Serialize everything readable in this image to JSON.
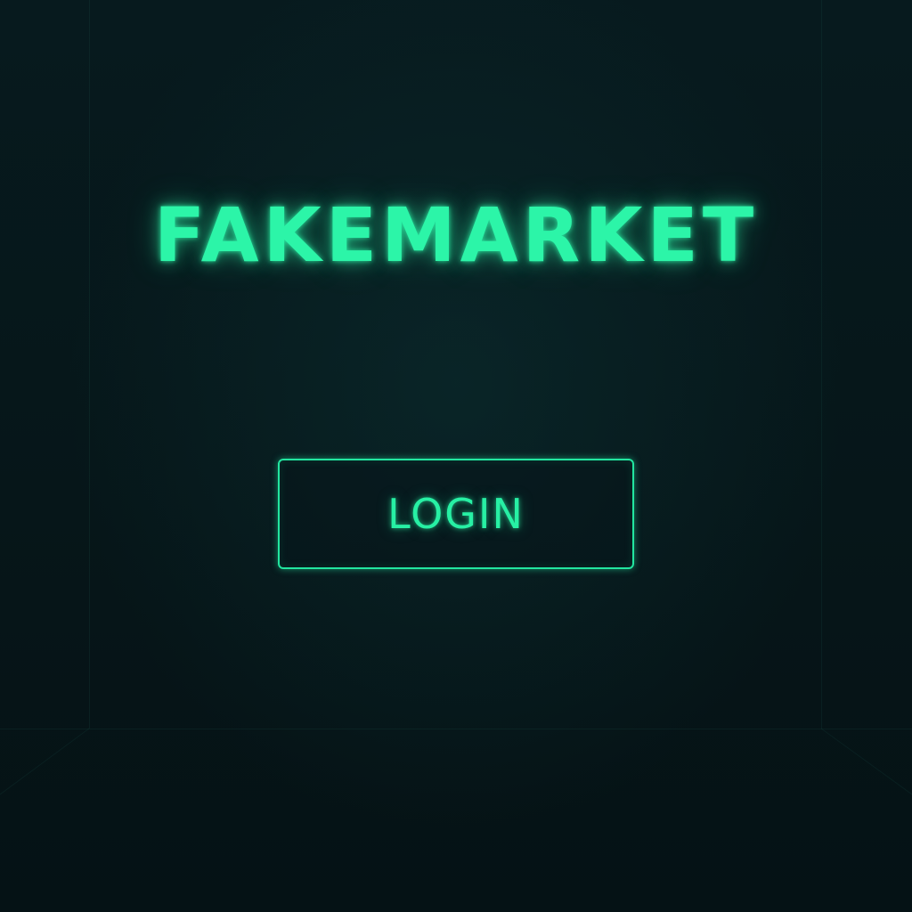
{
  "app": {
    "title": "FAKEMARKET"
  },
  "login_button": {
    "label": "LOGIN"
  },
  "colors": {
    "accent": "#2cf5a8",
    "background": "#06161a"
  }
}
